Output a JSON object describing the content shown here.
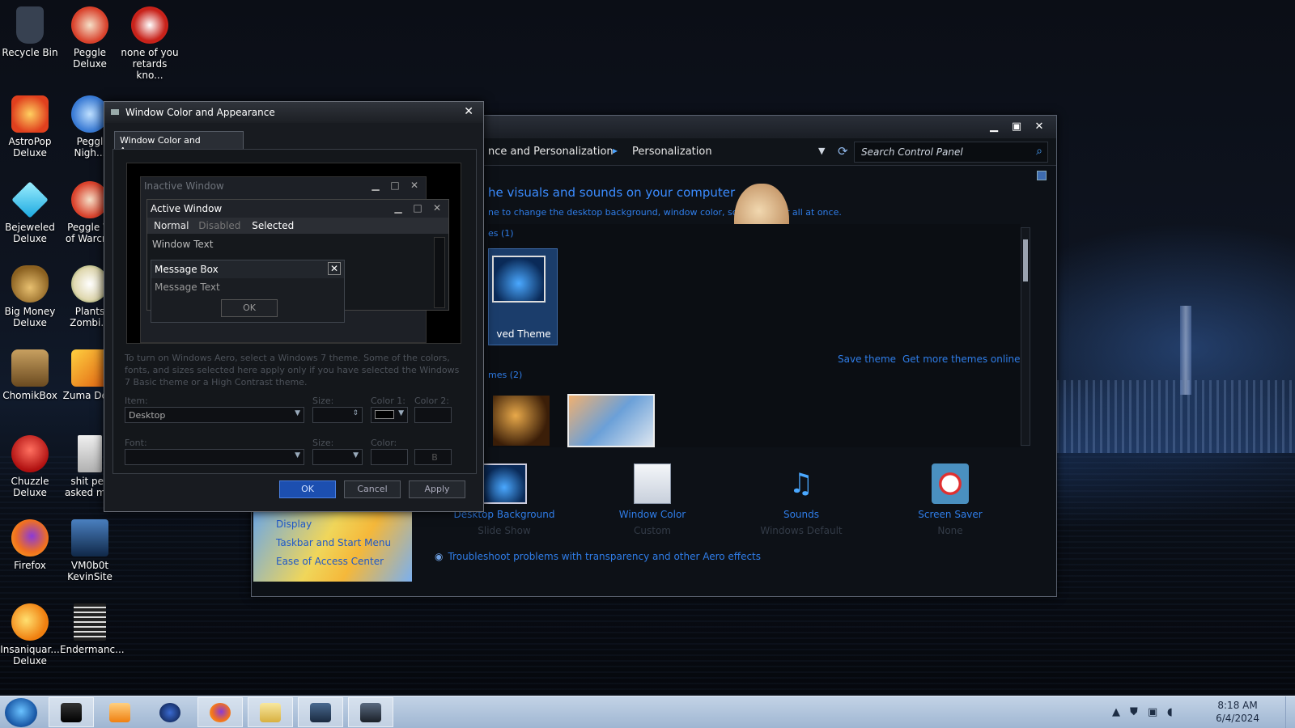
{
  "desktop": {
    "icons": [
      {
        "label": "Recycle Bin",
        "icon": "recycle-bin-icon",
        "color": "#4b5563"
      },
      {
        "label": "Peggle\nDeluxe",
        "icon": "peggle-icon",
        "color": "#d9412b"
      },
      {
        "label": "none of you\nretards kno...",
        "icon": "peggle-red-icon",
        "color": "#c8221a"
      },
      {
        "label": "AstroPop\nDeluxe",
        "icon": "astropop-icon",
        "color": "#e0801e"
      },
      {
        "label": "Peggl\nNigh...",
        "icon": "peggle-nights-icon",
        "color": "#3a7bd5"
      },
      {
        "label": "Bejeweled\nDeluxe",
        "icon": "gem-icon",
        "color": "#2ec4f0"
      },
      {
        "label": "Peggle W\nof Warcr...",
        "icon": "peggle-wow-icon",
        "color": "#d9412b"
      },
      {
        "label": "Big Money\nDeluxe",
        "icon": "money-bag-icon",
        "color": "#b08a3a"
      },
      {
        "label": "Plants\nZombi...",
        "icon": "plants-zombies-icon",
        "color": "#e8e0c8"
      },
      {
        "label": "ChomikBox",
        "icon": "chomikbox-icon",
        "color": "#8a6a3a"
      },
      {
        "label": "Zuma De...",
        "icon": "zuma-icon",
        "color": "#e0a020"
      },
      {
        "label": "Chuzzle\nDeluxe",
        "icon": "chuzzle-icon",
        "color": "#d8302a"
      },
      {
        "label": "shit pec\nasked m...",
        "icon": "document-icon",
        "color": "#d0d0d0"
      },
      {
        "label": "Firefox",
        "icon": "firefox-icon",
        "color": "#f07020"
      },
      {
        "label": "VM0b0t\nKevinSite",
        "icon": "vm-icon",
        "color": "#3a70b0"
      },
      {
        "label": "Insaniquar...\nDeluxe",
        "icon": "fish-icon",
        "color": "#f0a020"
      },
      {
        "label": "Endermanc...",
        "icon": "text-file-icon",
        "color": "#e8e8e8"
      }
    ]
  },
  "personalization": {
    "breadcrumb_1": "nce and Personalization",
    "breadcrumb_2": "Personalization",
    "search_placeholder": "Search Control Panel",
    "heading": "he visuals and sounds on your computer",
    "subtext": "ne to change the desktop background, window color, sounds,   saver all at once.",
    "group_1": "es (1)",
    "saved_theme": "ved Theme",
    "save_theme": "Save theme",
    "more_themes": "Get more themes online",
    "group_2": "mes (2)",
    "settings": [
      {
        "label": "Desktop Background",
        "value": "Slide Show",
        "icon": "desktop-background-icon"
      },
      {
        "label": "Window Color",
        "value": "Custom",
        "icon": "window-color-icon"
      },
      {
        "label": "Sounds",
        "value": "Windows Default",
        "icon": "sounds-icon"
      },
      {
        "label": "Screen Saver",
        "value": "None",
        "icon": "screen-saver-icon"
      }
    ],
    "troubleshoot": "Troubleshoot problems with transparency and other Aero effects",
    "see_also": [
      "Display",
      "Taskbar and Start Menu",
      "Ease of Access Center"
    ]
  },
  "dialog": {
    "title": "Window Color and Appearance",
    "tab": "Window Color and Appearance",
    "preview": {
      "inactive": "Inactive Window",
      "active": "Active Window",
      "menu_normal": "Normal",
      "menu_disabled": "Disabled",
      "menu_selected": "Selected",
      "window_text": "Window Text",
      "message_box": "Message Box",
      "message_text": "Message Text",
      "ok": "OK"
    },
    "notice": "To turn on Windows Aero, select a Windows 7 theme. Some of the colors, fonts, and sizes selected here apply only if you have selected the Windows 7 Basic theme or a High Contrast theme.",
    "item_label": "Item:",
    "item_value": "Desktop",
    "size_label": "Size:",
    "color1_label": "Color 1:",
    "color2_label": "Color 2:",
    "font_label": "Font:",
    "font_size_label": "Size:",
    "font_color_label": "Color:",
    "bold_label": "B",
    "ok": "OK",
    "cancel": "Cancel",
    "apply": "Apply"
  },
  "taskbar": {
    "time": "8:18 AM",
    "date": "6/4/2024",
    "apps": [
      "file-explorer-dark-icon",
      "media-player-icon",
      "globe-icon",
      "firefox-icon",
      "folder-icon",
      "control-panel-icon",
      "display-icon"
    ]
  }
}
